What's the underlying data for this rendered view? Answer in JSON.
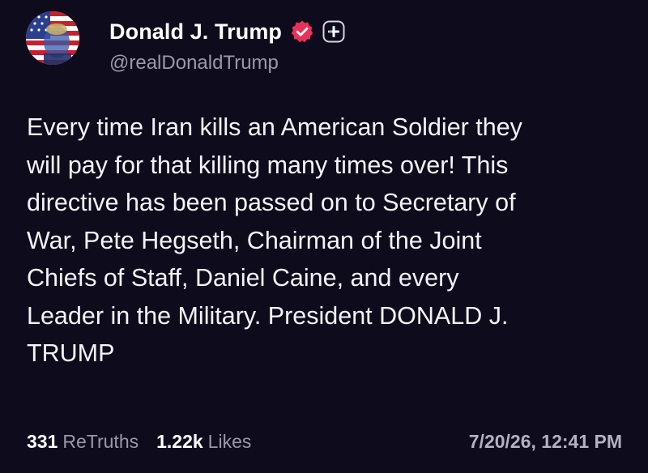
{
  "author": {
    "display_name": "Donald J. Trump",
    "handle": "@realDonaldTrump",
    "avatar_icon": "profile-avatar",
    "verified_icon": "verified-badge-icon",
    "follow_icon": "plus-icon"
  },
  "post": {
    "text": "Every time Iran kills an American Soldier they\nwill pay for that killing many times over! This\ndirective has been passed on to Secretary of\nWar, Pete Hegseth, Chairman of the Joint\nChiefs of Staff, Daniel Caine, and every\nLeader in the Military. President DONALD J.\nTRUMP"
  },
  "stats": {
    "retruths_count": "331",
    "retruths_label": "ReTruths",
    "likes_count": "1.22k",
    "likes_label": "Likes"
  },
  "timestamp": "7/20/26, 12:41 PM",
  "colors": {
    "background": "#0e0b1c",
    "text": "#f4f3f8",
    "muted": "#9b98a8",
    "verified": "#e8325a"
  }
}
